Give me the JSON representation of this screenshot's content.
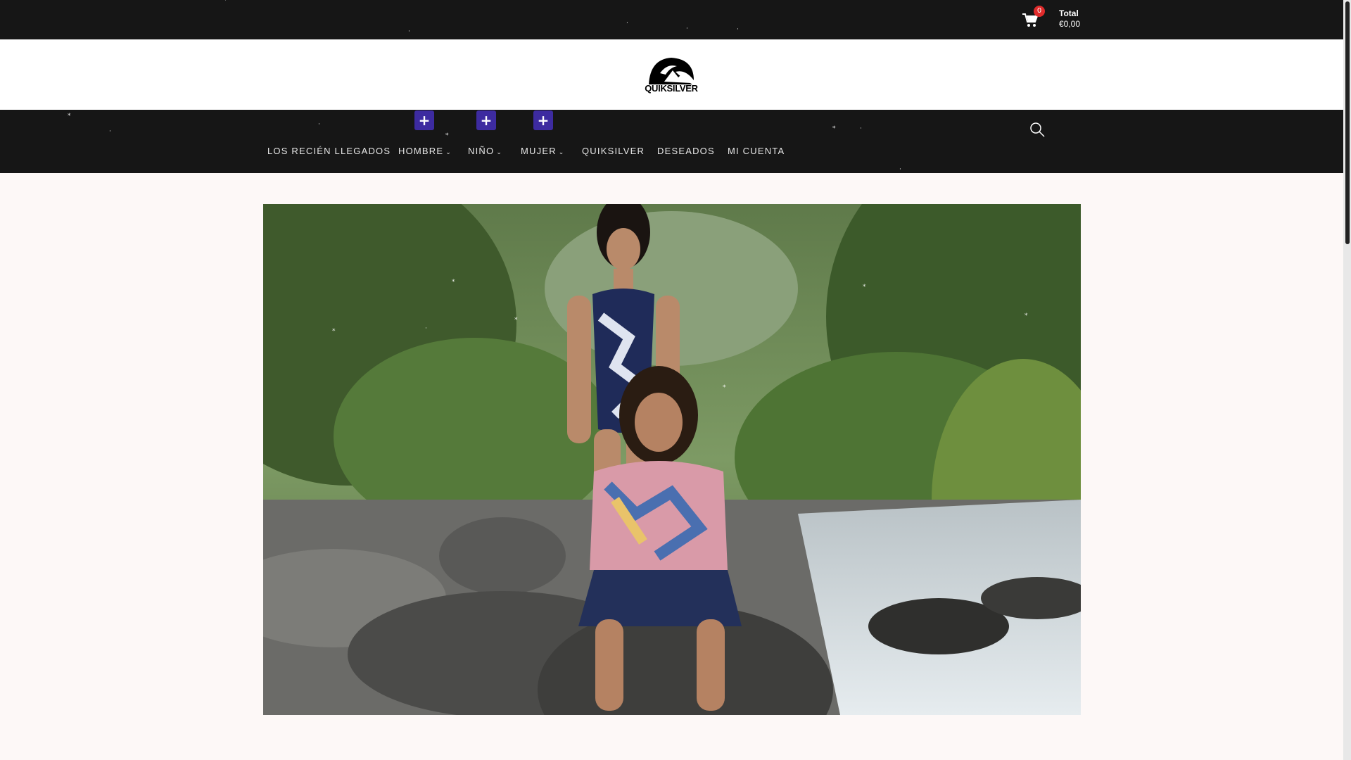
{
  "topbar": {
    "cart_count": "0",
    "total_label": "Total",
    "total_value": "€0,00"
  },
  "logo": {
    "text": "QUIKSILVER"
  },
  "nav": {
    "items": [
      {
        "label": "LOS RECIÉN LLEGADOS",
        "has_dropdown": false
      },
      {
        "label": "HOMBRE",
        "has_dropdown": true
      },
      {
        "label": "NIÑO",
        "has_dropdown": true
      },
      {
        "label": "MUJER",
        "has_dropdown": true
      },
      {
        "label": "QUIKSILVER",
        "has_dropdown": false
      },
      {
        "label": "DESEADOS",
        "has_dropdown": false
      },
      {
        "label": "MI CUENTA",
        "has_dropdown": false
      }
    ],
    "search_icon": "search-icon"
  },
  "colors": {
    "bar_bg": "#161616",
    "badge": "#e02b2b",
    "plus_button": "#3d2ba0",
    "page_bg": "#fdf8f7"
  }
}
